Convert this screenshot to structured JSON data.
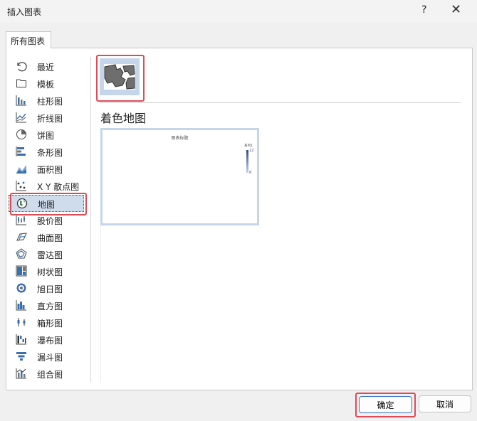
{
  "dialog": {
    "title": "插入图表",
    "help": "?",
    "close": "✕"
  },
  "tabs": [
    {
      "label": "所有图表"
    }
  ],
  "sidebar": {
    "items": [
      {
        "label": "最近",
        "icon": "recent-icon"
      },
      {
        "label": "模板",
        "icon": "template-folder-icon"
      },
      {
        "label": "柱形图",
        "icon": "column-chart-icon"
      },
      {
        "label": "折线图",
        "icon": "line-chart-icon"
      },
      {
        "label": "饼图",
        "icon": "pie-chart-icon"
      },
      {
        "label": "条形图",
        "icon": "bar-chart-icon"
      },
      {
        "label": "面积图",
        "icon": "area-chart-icon"
      },
      {
        "label": "X Y 散点图",
        "icon": "scatter-chart-icon"
      },
      {
        "label": "地图",
        "icon": "map-globe-icon",
        "selected": true
      },
      {
        "label": "股价图",
        "icon": "stock-chart-icon"
      },
      {
        "label": "曲面图",
        "icon": "surface-chart-icon"
      },
      {
        "label": "雷达图",
        "icon": "radar-chart-icon"
      },
      {
        "label": "树状图",
        "icon": "treemap-icon"
      },
      {
        "label": "旭日图",
        "icon": "sunburst-icon"
      },
      {
        "label": "直方图",
        "icon": "histogram-icon"
      },
      {
        "label": "箱形图",
        "icon": "box-whisker-icon"
      },
      {
        "label": "瀑布图",
        "icon": "waterfall-icon"
      },
      {
        "label": "漏斗图",
        "icon": "funnel-icon"
      },
      {
        "label": "组合图",
        "icon": "combo-chart-icon"
      }
    ]
  },
  "content": {
    "subtype_icon": "filled-map-thumbnail-icon",
    "subtype_title": "着色地图",
    "preview": {
      "chart_title": "图表标题",
      "legend_title": "系列1",
      "legend_max": "12",
      "legend_min": "8"
    }
  },
  "footer": {
    "ok": "确定",
    "cancel": "取消"
  },
  "colors": {
    "selection": "#cfdcec",
    "highlight": "#e04a57",
    "thumb_bg": "#c5d6ea",
    "primary_border": "#3b73c7"
  }
}
